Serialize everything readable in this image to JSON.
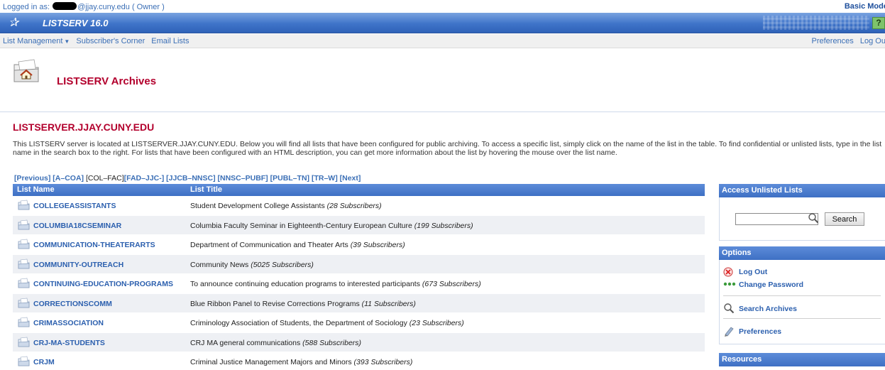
{
  "login": {
    "prefix": "Logged in as:",
    "email": "@jjay.cuny.edu",
    "role": "( Owner )",
    "mode_label": "Basic Mode"
  },
  "app": {
    "title": "LISTSERV 16.0",
    "help_label": "?"
  },
  "menu": {
    "left": [
      {
        "label": "List Management",
        "has_caret": true
      },
      {
        "label": "Subscriber's Corner"
      },
      {
        "label": "Email Lists"
      }
    ],
    "right": [
      {
        "label": "Preferences"
      },
      {
        "label": "Log Out"
      }
    ]
  },
  "page": {
    "title": "LISTSERV Archives"
  },
  "server": {
    "name": "LISTSERVER.JJAY.CUNY.EDU",
    "intro": "This LISTSERV server is located at LISTSERVER.JJAY.CUNY.EDU. Below you will find all lists that have been configured for public archiving. To access a specific list, simply click on the name of the list in the table. To find confidential or unlisted lists, type in the list name in the search box to the right. For lists that have been configured with an HTML description, you can get more information about the list by hovering the mouse over the list name."
  },
  "alpha_nav": {
    "previous": "[Previous]",
    "ranges": [
      {
        "label": "[A–COA]",
        "current": false
      },
      {
        "label": "[COL–FAC]",
        "current": true
      },
      {
        "label": "[FAD–JJC-]",
        "current": false
      },
      {
        "label": "[JJCB–NNSC]",
        "current": false
      },
      {
        "label": "[NNSC–PUBF]",
        "current": false
      },
      {
        "label": "[PUBL–TN]",
        "current": false
      },
      {
        "label": "[TR–W]",
        "current": false
      }
    ],
    "next": "[Next]"
  },
  "table": {
    "headers": {
      "name": "List Name",
      "title": "List Title"
    },
    "rows": [
      {
        "name": "COLLEGEASSISTANTS",
        "title": "Student Development College Assistants",
        "subs": "(28 Subscribers)"
      },
      {
        "name": "COLUMBIA18CSEMINAR",
        "title": "Columbia Faculty Seminar in Eighteenth-Century European Culture",
        "subs": "(199 Subscribers)"
      },
      {
        "name": "COMMUNICATION-THEATERARTS",
        "title": "Department of Communication and Theater Arts",
        "subs": "(39 Subscribers)"
      },
      {
        "name": "COMMUNITY-OUTREACH",
        "title": "Community News",
        "subs": "(5025 Subscribers)"
      },
      {
        "name": "CONTINUING-EDUCATION-PROGRAMS",
        "title": "To announce continuing education programs to interested participants",
        "subs": "(673 Subscribers)"
      },
      {
        "name": "CORRECTIONSCOMM",
        "title": "Blue Ribbon Panel to Revise Corrections Programs",
        "subs": "(11 Subscribers)"
      },
      {
        "name": "CRIMASSOCIATION",
        "title": "Criminology Association of Students, the Department of Sociology",
        "subs": "(23 Subscribers)"
      },
      {
        "name": "CRJ-MA-STUDENTS",
        "title": "CRJ MA general communications",
        "subs": "(588 Subscribers)"
      },
      {
        "name": "CRJM",
        "title": "Criminal Justice Management Majors and Minors",
        "subs": "(393 Subscribers)"
      }
    ]
  },
  "access_panel": {
    "title": "Access Unlisted Lists",
    "search_value": "",
    "search_button": "Search"
  },
  "options_panel": {
    "title": "Options",
    "items": [
      {
        "label": "Log Out",
        "icon": "logout-x-icon"
      },
      {
        "label": "Change Password",
        "icon": "password-dots-icon"
      },
      {
        "label": "Search Archives",
        "icon": "magnifier-icon"
      },
      {
        "label": "Preferences",
        "icon": "pencil-icon"
      }
    ]
  },
  "resources_panel": {
    "title": "Resources"
  },
  "colors": {
    "brand_blue": "#3f74c9",
    "title_red": "#b3002d",
    "link_blue": "#2b5fae"
  }
}
